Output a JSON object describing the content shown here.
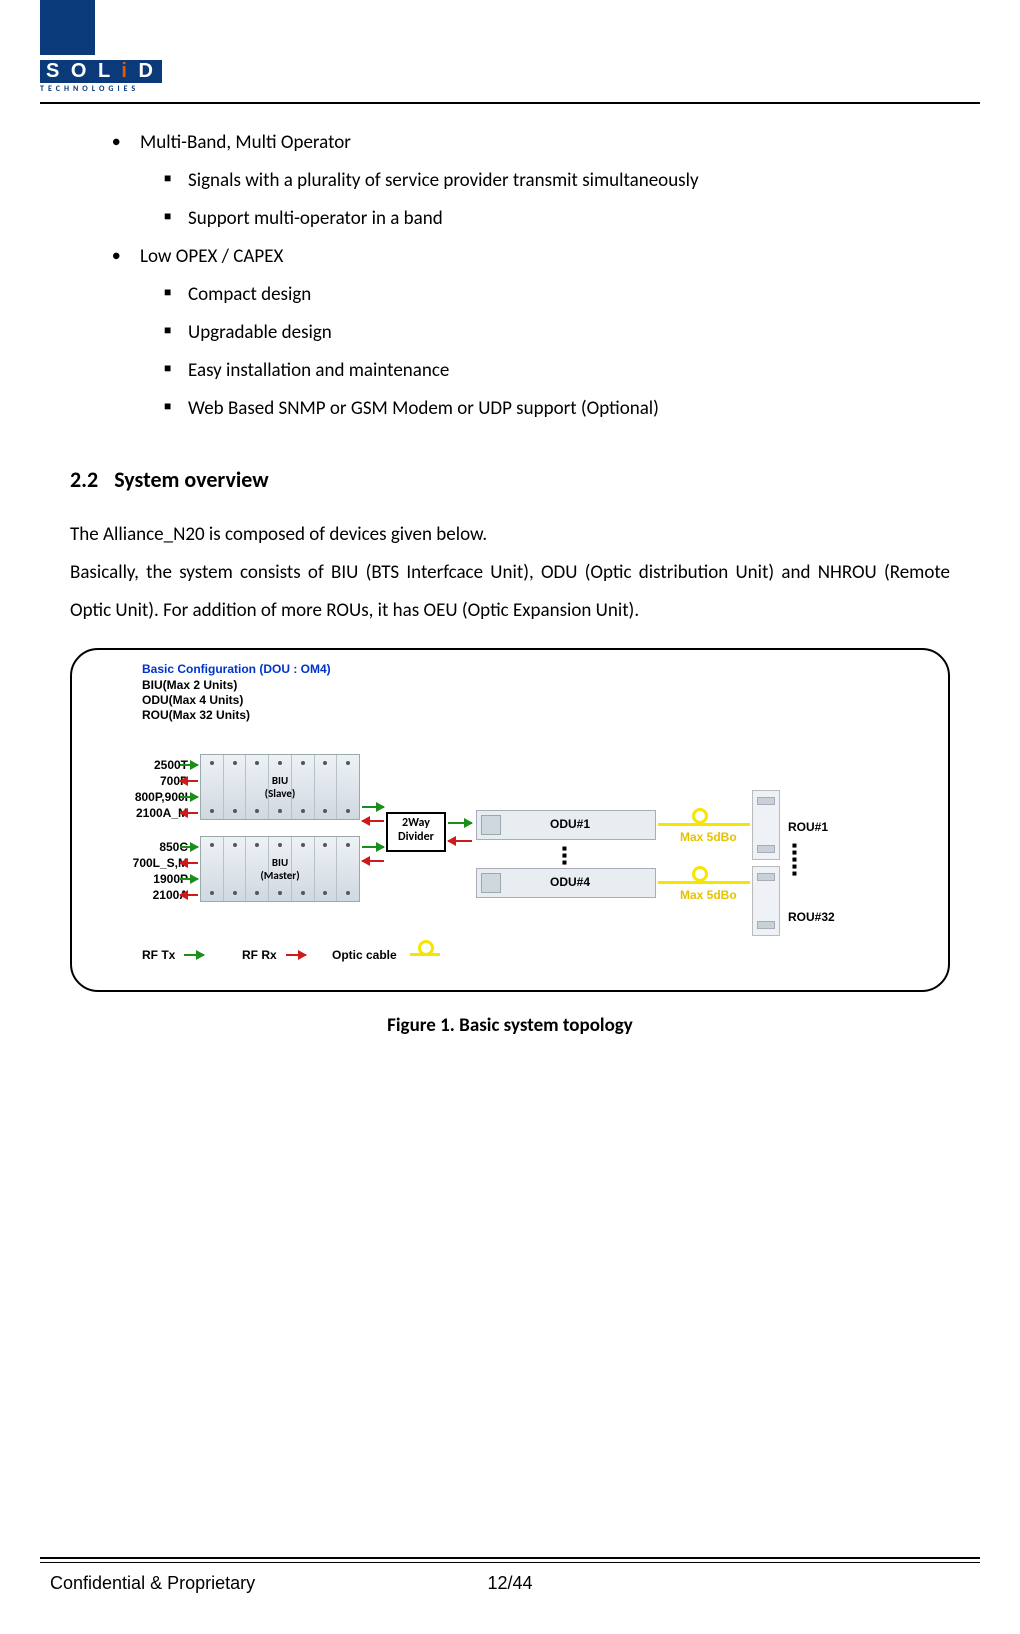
{
  "logo": {
    "text": "SOLiD",
    "sub": "TECHNOLOGIES"
  },
  "bullets": {
    "b1": "Multi-Band, Multi Operator",
    "b1_sub": [
      "Signals with a plurality of service provider transmit simultaneously",
      "Support multi-operator in a band"
    ],
    "b2": "Low OPEX / CAPEX",
    "b2_sub": [
      "Compact design",
      "Upgradable design",
      "Easy installation and maintenance",
      "Web Based SNMP or GSM Modem or UDP support (Optional)"
    ]
  },
  "section": {
    "num": "2.2",
    "title": "System overview"
  },
  "para1": "The Alliance_N20 is composed of devices given below.",
  "para2": "Basically, the system consists of BIU (BTS Interfcace Unit), ODU (Optic distribution Unit) and NHROU (Remote Optic Unit). For addition of more ROUs, it has OEU (Optic Expansion Unit).",
  "diagram": {
    "header": {
      "l1": "Basic Configuration (DOU : OM4)",
      "l2": "BIU(Max 2 Units)",
      "l3": "ODU(Max 4 Units)",
      "l4": "ROU(Max 32 Units)"
    },
    "left_bands_top": [
      "2500T",
      "700P",
      "800P,900I",
      "2100A_M"
    ],
    "left_bands_bot": [
      "850C",
      "700L_S,M",
      "1900P",
      "2100A"
    ],
    "biu_slave": "BIU\n(Slave)",
    "biu_master": "BIU\n(Master)",
    "divider": "2Way\nDivider",
    "odu1": "ODU#1",
    "odu4": "ODU#4",
    "max5": "Max 5dBo",
    "rou1": "ROU#1",
    "rou32": "ROU#32",
    "legend": {
      "rftx": "RF Tx",
      "rfrx": "RF Rx",
      "optic": "Optic cable"
    }
  },
  "figure_caption": "Figure 1. Basic system topology",
  "footer": {
    "left": "Confidential & Proprietary",
    "center": "12/44"
  }
}
